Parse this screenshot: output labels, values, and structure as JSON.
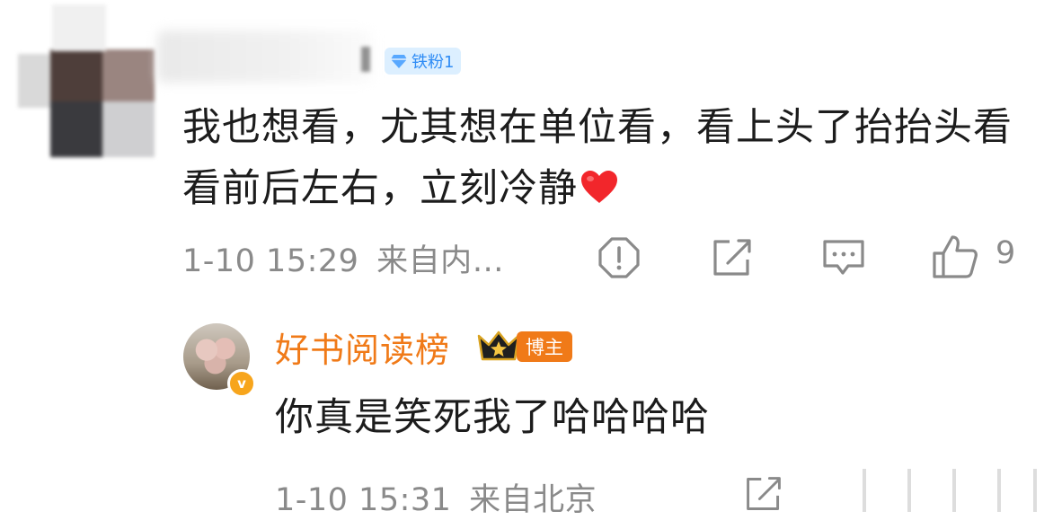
{
  "comment": {
    "fan_badge": "铁粉1",
    "text": "我也想看，尤其想在单位看，看上头了抬抬头看看前后左右，立刻冷静",
    "timestamp": "1-10 15:29",
    "location": "来自内…",
    "like_count": "9",
    "icons": [
      "report-icon",
      "share-icon",
      "comment-icon",
      "like-icon"
    ]
  },
  "reply": {
    "author": "好书阅读榜",
    "role_badge": "博主",
    "text": "你真是笑死我了哈哈哈哈",
    "timestamp": "1-10 15:31",
    "location": "来自北京"
  },
  "colors": {
    "author_orange": "#f07a18",
    "fan_badge_blue": "#2f8cf5",
    "meta_gray": "#8a8a8a",
    "heart_red": "#f2262b"
  }
}
